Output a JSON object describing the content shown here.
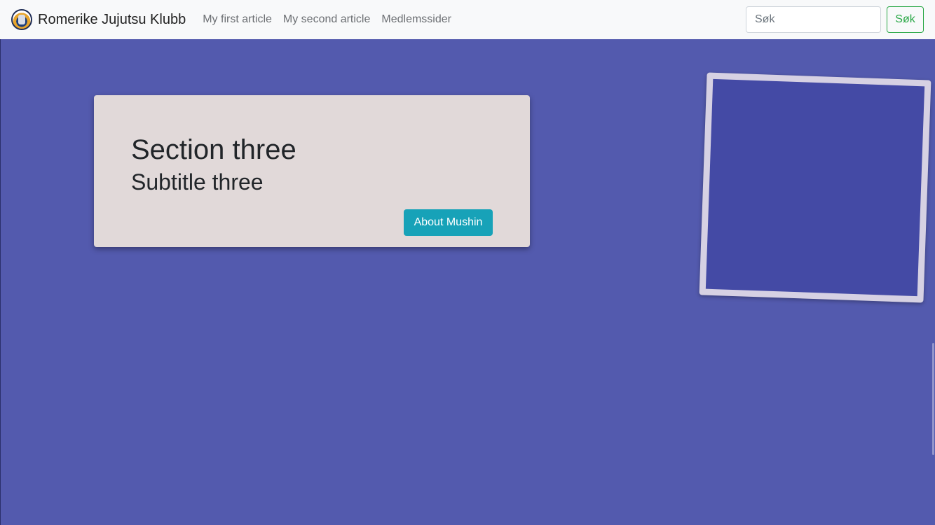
{
  "navbar": {
    "brand": "Romerike Jujutsu Klubb",
    "links": [
      "My first article",
      "My second article",
      "Medlemssider"
    ],
    "search_placeholder": "Søk",
    "search_button": "Søk"
  },
  "card": {
    "title": "Section three",
    "subtitle": "Subtitle three",
    "button": "About Mushin"
  },
  "colors": {
    "page_background": "#535aae",
    "card_background": "#e1d9d9",
    "accent_button": "#17a2b8",
    "search_button": "#28a745"
  },
  "icons": {
    "logo": "club-logo-icon"
  }
}
